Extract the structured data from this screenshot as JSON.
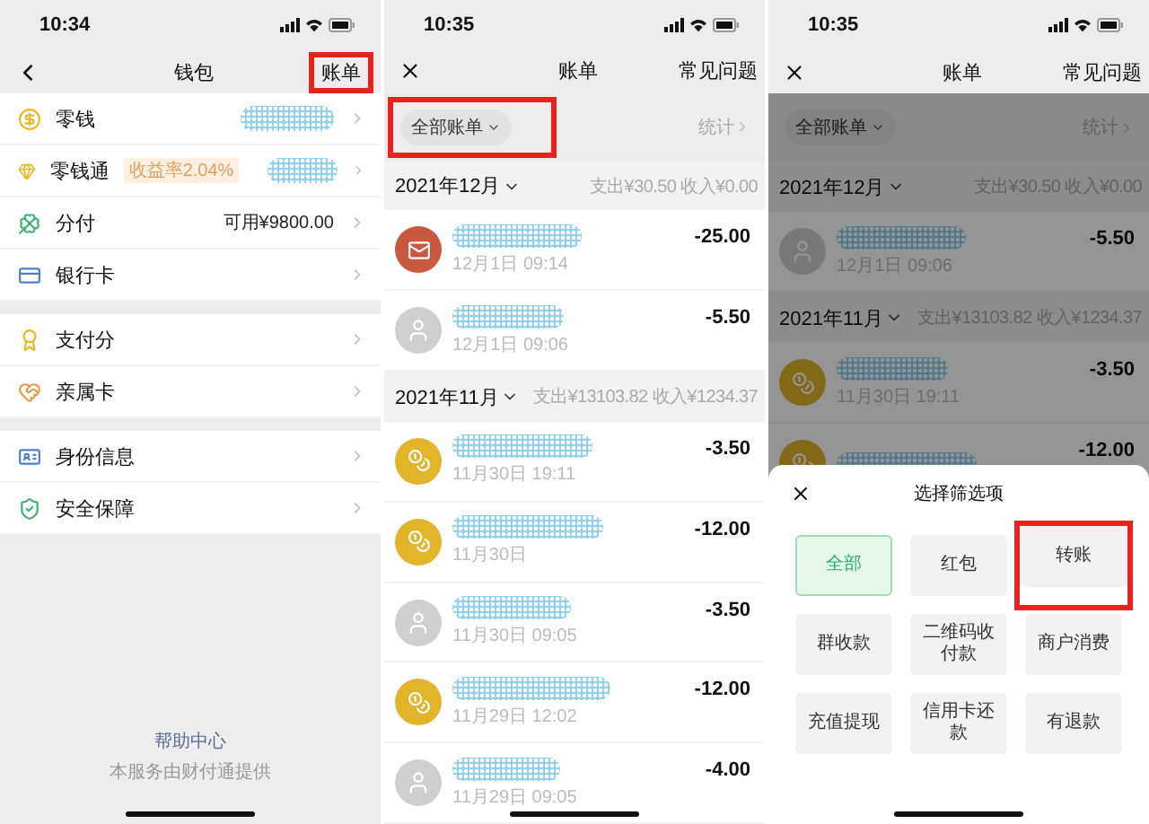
{
  "wallet": {
    "status_time": "10:34",
    "title": "钱包",
    "bill_link": {
      "label": "账单",
      "highlighted": true
    },
    "groups": [
      [
        {
          "label": "零钱",
          "redacted": true
        },
        {
          "label": "零钱通",
          "badge": "收益率2.04%",
          "redacted": true
        },
        {
          "label": "分付",
          "value": "可用¥9800.00",
          "redacted": false
        },
        {
          "label": "银行卡",
          "redacted": false
        }
      ],
      [
        {
          "label": "支付分",
          "redacted": false
        },
        {
          "label": "亲属卡",
          "redacted": false
        }
      ],
      [
        {
          "label": "身份信息",
          "redacted": false
        },
        {
          "label": "安全保障",
          "redacted": false
        }
      ]
    ],
    "help_link": "帮助中心",
    "provider_note": "本服务由财付通提供"
  },
  "bills": {
    "status_time": "10:35",
    "title": "账单",
    "faq": "常见问题",
    "filter": {
      "label": "全部账单",
      "highlighted": true
    },
    "stats": "统计",
    "months": [
      {
        "month": "2021年12月",
        "summary": "支出¥30.50 收入¥0.00",
        "items": [
          {
            "kind": "red_packet",
            "time": "12月1日 09:14",
            "amount": "-25.00",
            "redacted": true
          },
          {
            "kind": "person",
            "time": "12月1日 09:06",
            "amount": "-5.50",
            "redacted": true
          }
        ]
      },
      {
        "month": "2021年11月",
        "summary": "支出¥13103.82 收入¥1234.37",
        "items": [
          {
            "kind": "money_bag",
            "time": "11月30日 19:11",
            "amount": "-3.50",
            "redacted": true
          },
          {
            "kind": "money_bag",
            "time": "11月30日",
            "amount": "-12.00",
            "redacted": true
          },
          {
            "kind": "person",
            "time": "11月30日 09:05",
            "amount": "-3.50",
            "redacted": true
          },
          {
            "kind": "money_bag",
            "time": "11月29日 12:02",
            "amount": "-12.00",
            "redacted": true
          },
          {
            "kind": "person",
            "time": "11月29日 09:05",
            "amount": "-4.00",
            "redacted": true
          }
        ]
      }
    ]
  },
  "filter_screen": {
    "status_time": "10:35",
    "title": "账单",
    "faq": "常见问题",
    "filter": {
      "label": "全部账单",
      "highlighted": false
    },
    "stats": "统计",
    "months": [
      {
        "month": "2021年12月",
        "summary": "支出¥30.50 收入¥0.00",
        "items": [
          {
            "kind": "person",
            "time": "12月1日 09:06",
            "amount": "-5.50",
            "redacted": true
          }
        ]
      },
      {
        "month": "2021年11月",
        "summary": "支出¥13103.82 收入¥1234.37",
        "items": [
          {
            "kind": "money_bag",
            "time": "11月30日 19:11",
            "amount": "-3.50",
            "redacted": true
          },
          {
            "kind": "money_bag",
            "amount": "-12.00",
            "redacted": true
          }
        ]
      }
    ],
    "sheet": {
      "title": "选择筛选项",
      "options": [
        {
          "label": "全部",
          "selected": true,
          "highlighted": false
        },
        {
          "label": "红包",
          "selected": false,
          "highlighted": false
        },
        {
          "label": "转账",
          "selected": false,
          "highlighted": true
        },
        {
          "label": "群收款",
          "selected": false,
          "highlighted": false
        },
        {
          "label": "二维码收付款",
          "selected": false,
          "highlighted": false
        },
        {
          "label": "商户消费",
          "selected": false,
          "highlighted": false
        },
        {
          "label": "充值提现",
          "selected": false,
          "highlighted": false
        },
        {
          "label": "信用卡还款",
          "selected": false,
          "highlighted": false
        },
        {
          "label": "有退款",
          "selected": false,
          "highlighted": false
        }
      ]
    }
  }
}
